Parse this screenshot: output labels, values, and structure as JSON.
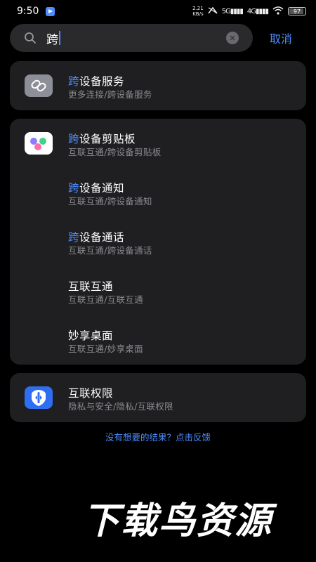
{
  "status": {
    "time": "9:50",
    "net_speed_value": "2.21",
    "net_speed_unit": "KB/s",
    "net1": "5G",
    "net2": "4G",
    "battery": "97"
  },
  "search": {
    "query": "跨",
    "cancel_label": "取消",
    "clear_symbol": "✕"
  },
  "results": {
    "group1": [
      {
        "highlight": "跨",
        "title_rest": "设备服务",
        "subtitle": "更多连接/跨设备服务"
      }
    ],
    "group2": [
      {
        "highlight": "跨",
        "title_rest": "设备剪贴板",
        "subtitle": "互联互通/跨设备剪贴板"
      },
      {
        "highlight": "跨",
        "title_rest": "设备通知",
        "subtitle": "互联互通/跨设备通知"
      },
      {
        "highlight": "跨",
        "title_rest": "设备通话",
        "subtitle": "互联互通/跨设备通话"
      },
      {
        "highlight": "",
        "title_rest": "互联互通",
        "subtitle": "互联互通/互联互通"
      },
      {
        "highlight": "",
        "title_rest": "妙享桌面",
        "subtitle": "互联互通/妙享桌面"
      }
    ],
    "group3": [
      {
        "highlight": "",
        "title_rest": "互联权限",
        "subtitle": "隐私与安全/隐私/互联权限"
      }
    ]
  },
  "feedback_text": "没有想要的结果？点击反馈",
  "watermark_text": "下载鸟资源",
  "colors": {
    "accent": "#4d8dff",
    "card": "#1f1f21",
    "background": "#000000"
  }
}
